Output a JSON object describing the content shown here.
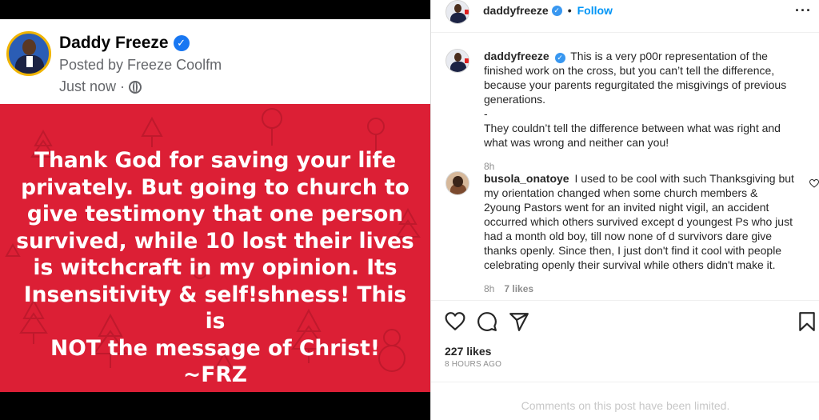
{
  "fb_post": {
    "name": "Daddy Freeze",
    "posted_by": "Posted by Freeze Coolfm",
    "time": "Just now ·",
    "poster_text": "Thank God for saving your life\nprivately. But going to church to\ngive testimony that one person\nsurvived, while 10 lost their lives\nis witchcraft in my opinion. Its\nInsensitivity & self!shness! This is\nNOT the message of Christ!\n~FRZ"
  },
  "header": {
    "username": "daddyfreeze",
    "separator": "•",
    "follow_label": "Follow",
    "more_label": "···"
  },
  "comments": [
    {
      "username": "daddyfreeze",
      "text": "This is a very p00r representation of the finished work on the cross, but you can’t tell the difference, because your parents regurgitated the misgivings of previous generations.",
      "dash": "-",
      "text2": "They couldn’t tell the difference between what was right and what was wrong and neither can you!",
      "time": "8h"
    },
    {
      "username": "busola_onatoye",
      "text": "I used to be cool with such Thanksgiving but my orientation changed when some church members & 2young Pastors went for an invited night vigil, an accident occurred which others survived except d youngest Ps who just had a month old boy, till now none of d survivors dare give thanks openly. Since then, I just don't find it cool with people celebrating openly their survival while others didn't make it.",
      "time": "8h",
      "likes": "7 likes"
    }
  ],
  "post_stats": {
    "likes": "227 likes",
    "age": "8 HOURS AGO",
    "limited_notice": "Comments on this post have been limited."
  },
  "colors": {
    "poster_red": "#dc1f35",
    "ig_blue": "#0095f6",
    "fb_blue": "#1877f2"
  }
}
